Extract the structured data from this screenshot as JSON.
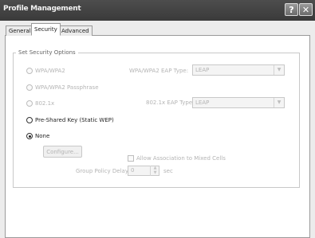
{
  "window": {
    "title": "Profile Management"
  },
  "titlebar": {
    "help_glyph": "?",
    "close_glyph": "✕"
  },
  "tabs": [
    {
      "label": "General",
      "active": false
    },
    {
      "label": "Security",
      "active": true
    },
    {
      "label": "Advanced",
      "active": false
    }
  ],
  "security_group": {
    "legend": "Set Security Options",
    "options": [
      {
        "label": "WPA/WPA2",
        "enabled": false,
        "selected": false
      },
      {
        "label": "WPA/WPA2 Passphrase",
        "enabled": false,
        "selected": false
      },
      {
        "label": "802.1x",
        "enabled": false,
        "selected": false
      },
      {
        "label": "Pre-Shared Key (Static WEP)",
        "enabled": true,
        "selected": false
      },
      {
        "label": "None",
        "enabled": true,
        "selected": true
      }
    ],
    "wpa_eap_type": {
      "label": "WPA/WPA2 EAP Type:",
      "value": "LEAP"
    },
    "eap_802_1x_type": {
      "label": "802.1x EAP Type:",
      "value": "LEAP"
    },
    "configure_label": "Configure...",
    "allow_association_label": "Allow Association to Mixed Cells",
    "group_policy_delay": {
      "label": "Group Policy Delay:",
      "value": "0",
      "unit": "sec"
    }
  },
  "colors": {
    "titlebar": "#3f3f3f",
    "disabled_text": "#b4b4b4",
    "enabled_text": "#222222"
  }
}
